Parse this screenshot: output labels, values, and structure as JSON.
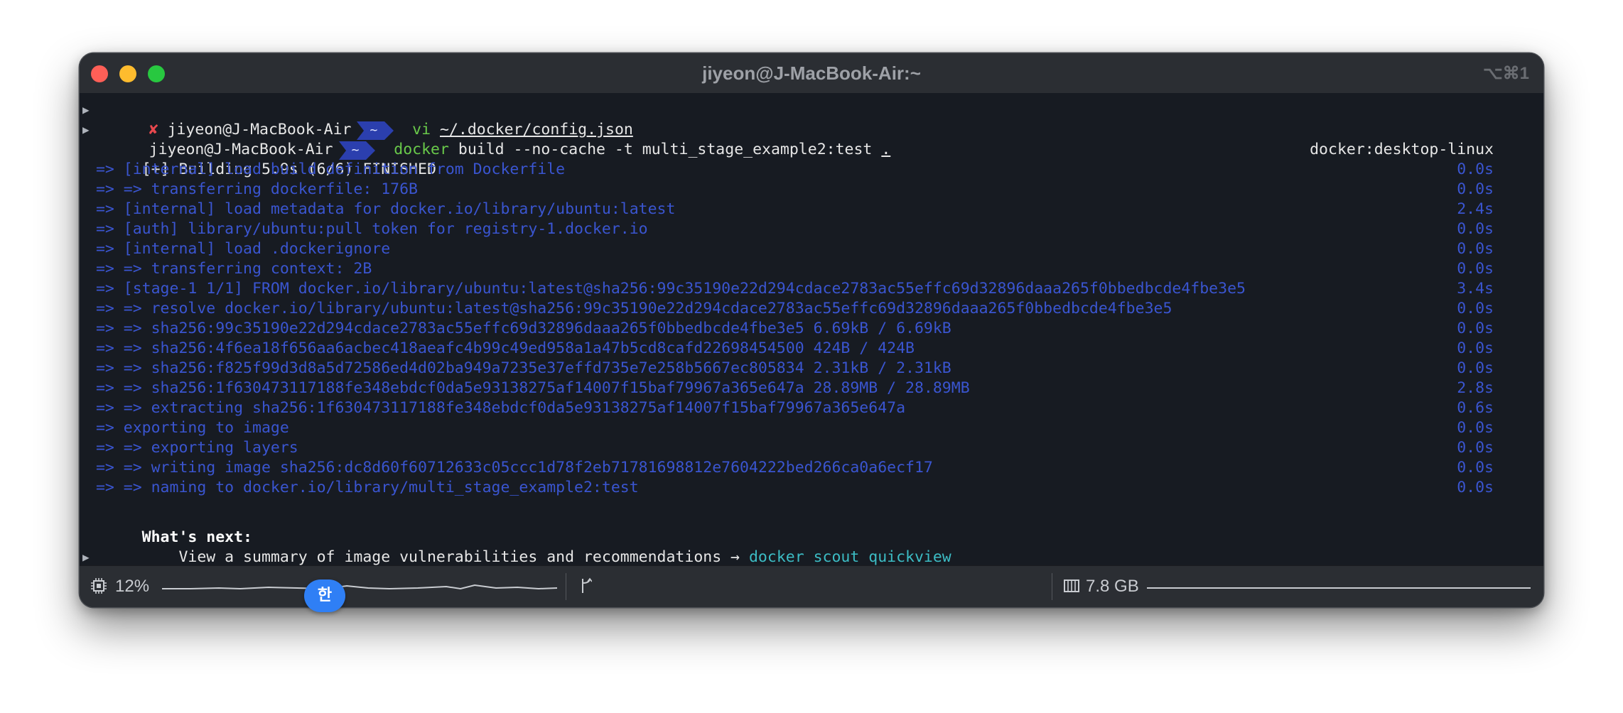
{
  "window": {
    "title": "jiyeon@J-MacBook-Air:~",
    "shortcut": "⌥⌘1"
  },
  "prompt": {
    "user": "jiyeon@J-MacBook-Air",
    "dir": "~",
    "error_mark": "✘"
  },
  "commands": [
    {
      "cmd": "vi",
      "args": "~/.docker/config.json"
    },
    {
      "cmd": "docker",
      "args_pre": "build --no-cache -t multi_stage_example2:test ",
      "args_ul": "."
    }
  ],
  "build_header": {
    "text": "[+] Building 5.9s (6/6) FINISHED",
    "context": "docker:desktop-linux"
  },
  "build_steps": [
    {
      "text": " => [internal] load build definition from Dockerfile",
      "time": "0.0s"
    },
    {
      "text": " => => transferring dockerfile: 176B",
      "time": "0.0s"
    },
    {
      "text": " => [internal] load metadata for docker.io/library/ubuntu:latest",
      "time": "2.4s"
    },
    {
      "text": " => [auth] library/ubuntu:pull token for registry-1.docker.io",
      "time": "0.0s"
    },
    {
      "text": " => [internal] load .dockerignore",
      "time": "0.0s"
    },
    {
      "text": " => => transferring context: 2B",
      "time": "0.0s"
    },
    {
      "text": " => [stage-1 1/1] FROM docker.io/library/ubuntu:latest@sha256:99c35190e22d294cdace2783ac55effc69d32896daaa265f0bbedbcde4fbe3e5",
      "time": "3.4s"
    },
    {
      "text": " => => resolve docker.io/library/ubuntu:latest@sha256:99c35190e22d294cdace2783ac55effc69d32896daaa265f0bbedbcde4fbe3e5",
      "time": "0.0s"
    },
    {
      "text": " => => sha256:99c35190e22d294cdace2783ac55effc69d32896daaa265f0bbedbcde4fbe3e5 6.69kB / 6.69kB",
      "time": "0.0s"
    },
    {
      "text": " => => sha256:4f6ea18f656aa6acbec418aeafc4b99c49ed958a1a47b5cd8cafd22698454500 424B / 424B",
      "time": "0.0s"
    },
    {
      "text": " => => sha256:f825f99d3d8a5d72586ed4d02ba949a7235e37effd735e7e258b5667ec805834 2.31kB / 2.31kB",
      "time": "0.0s"
    },
    {
      "text": " => => sha256:1f630473117188fe348ebdcf0da5e93138275af14007f15baf79967a365e647a 28.89MB / 28.89MB",
      "time": "2.8s"
    },
    {
      "text": " => => extracting sha256:1f630473117188fe348ebdcf0da5e93138275af14007f15baf79967a365e647a",
      "time": "0.6s"
    },
    {
      "text": " => exporting to image",
      "time": "0.0s"
    },
    {
      "text": " => => exporting layers",
      "time": "0.0s"
    },
    {
      "text": " => => writing image sha256:dc8d60f60712633c05ccc1d78f2eb71781698812e7604222bed266ca0a6ecf17",
      "time": "0.0s"
    },
    {
      "text": " => => naming to docker.io/library/multi_stage_example2:test",
      "time": "0.0s"
    }
  ],
  "whats_next": {
    "heading": "What's next:",
    "text": "    View a summary of image vulnerabilities and recommendations → ",
    "command": "docker scout quickview"
  },
  "statusbar": {
    "cpu": "12%",
    "memory": "7.8 GB",
    "ime": "한"
  },
  "colors": {
    "background": "#171b22",
    "buildkit_blue": "#3a55d0",
    "prompt_segment": "#2b3fae",
    "command_green": "#69c94a",
    "link_cyan": "#3cbcc4"
  }
}
